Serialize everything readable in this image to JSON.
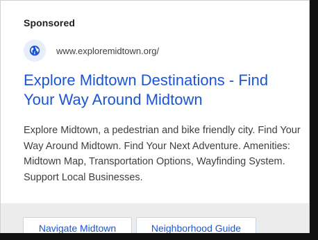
{
  "ad": {
    "sponsored_label": "Sponsored",
    "globe_icon": "globe-icon",
    "display_url": "www.exploremidtown.org/",
    "headline": "Explore Midtown Destinations - Find Your Way Around Midtown",
    "description": "Explore Midtown, a pedestrian and bike friendly city. Find Your Way Around Midtown. Find Your Next Adventure. Amenities: Midtown Map, Transportation Options, Wayfinding System. Support Local Businesses.",
    "sitelinks": [
      {
        "label": "Navigate Midtown"
      },
      {
        "label": "Neighborhood Guide"
      }
    ]
  },
  "colors": {
    "headline_link": "#1a55d6",
    "body_text": "#3c4043",
    "globe_badge_bg": "#e8eef9",
    "globe_fill": "#1a55d6",
    "footer_bg": "#ececec",
    "page_bg": "#111111"
  }
}
